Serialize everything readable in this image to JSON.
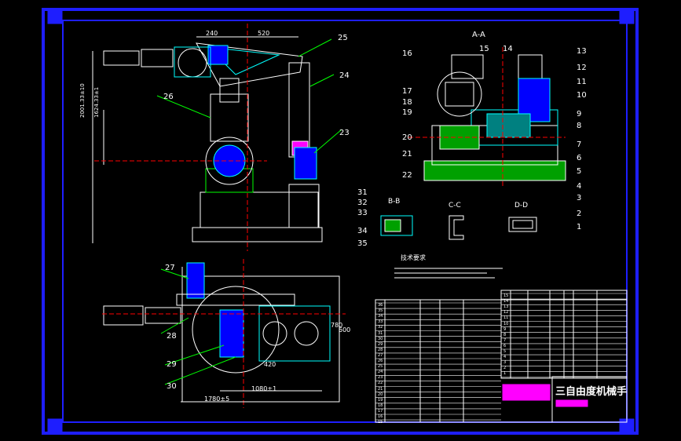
{
  "title_block": {
    "drawing_title": "三自由度机械手"
  },
  "section_labels": {
    "aa": "A-A",
    "bb": "B-B",
    "cc": "C-C",
    "dd": "D-D",
    "tech_req": "技术要求"
  },
  "dimensions": {
    "d240": "240",
    "d520": "520",
    "d1780": "1780±5",
    "d1080": "1080±1",
    "d780": "780",
    "d600": "600",
    "d420": "420",
    "d2001": "2001.33±10",
    "d1624": "1624.33±1"
  },
  "part_callouts": [
    "1",
    "2",
    "3",
    "4",
    "5",
    "6",
    "7",
    "8",
    "9",
    "10",
    "11",
    "12",
    "13",
    "14",
    "15",
    "16",
    "17",
    "18",
    "19",
    "20",
    "21",
    "22",
    "23",
    "24",
    "25",
    "26",
    "27",
    "28",
    "29",
    "30",
    "31",
    "32",
    "33",
    "34",
    "35"
  ],
  "bom_row_numbers_left": [
    "36",
    "35",
    "34",
    "33",
    "32",
    "31",
    "30",
    "29",
    "28",
    "27",
    "26",
    "25",
    "24",
    "23",
    "22",
    "21",
    "20",
    "19",
    "18",
    "17",
    "16",
    "15"
  ],
  "bom_row_numbers_right": [
    "15",
    "14",
    "13",
    "12",
    "11",
    "10",
    "9",
    "8",
    "7",
    "6",
    "5",
    "4",
    "3",
    "2",
    "1"
  ],
  "colors": {
    "frame": "#1e1eff",
    "line": "#ffffff",
    "accent_green": "#00c800",
    "accent_yellow": "#ffff00",
    "accent_cyan": "#00ffff",
    "accent_blue": "#0000ff",
    "accent_red": "#ff0000",
    "accent_magenta": "#ff00ff"
  }
}
